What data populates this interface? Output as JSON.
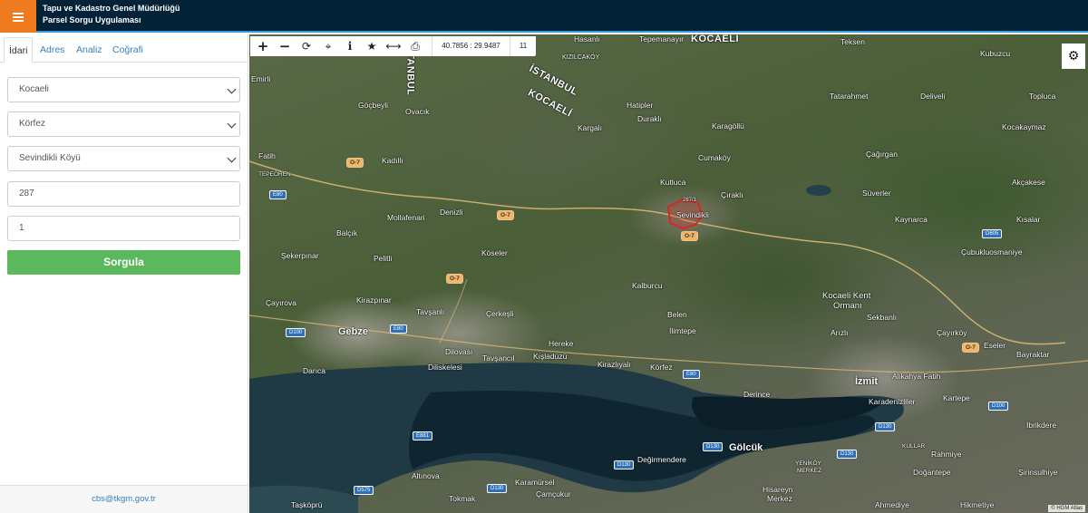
{
  "header": {
    "title_line1": "Tapu ve Kadastro Genel Müdürlüğü",
    "title_line2": "Parsel Sorgu Uygulaması"
  },
  "tabs": [
    {
      "label": "İdari",
      "active": true
    },
    {
      "label": "Adres"
    },
    {
      "label": "Analiz"
    },
    {
      "label": "Coğrafi"
    }
  ],
  "form": {
    "province": "Kocaeli",
    "district": "Körfez",
    "neighborhood": "Sevindikli Köyü",
    "block": "287",
    "parcel": "1",
    "query_label": "Sorgula"
  },
  "footer": {
    "email": "cbs@tkgm.gov.tr"
  },
  "toolbar": {
    "coords": "40.7856 : 29.9487",
    "zoom": "11",
    "icons": [
      "zoom-in-icon",
      "zoom-out-icon",
      "refresh-icon",
      "locate-icon",
      "info-icon",
      "star-icon",
      "measure-icon",
      "print-icon"
    ]
  },
  "map": {
    "attribution": "© HGM Atlas",
    "labels": {
      "hasanli": "Hasanlı",
      "tepemanayir": "Tepemanayır",
      "kocaeli_top": "KOCAELİ",
      "teksen": "Teksen",
      "kubuzcu": "Kubuzcu",
      "kizilcakoy": "KIZILCAKÖY",
      "istanbul_top": "İSTANBUL",
      "istanbul": "İSTANBUL",
      "kocaeli": "KOCAELİ",
      "tatarahmet": "Tatarahmet",
      "deliveli": "Deliveli",
      "topluca": "Topluca",
      "emirli": "Emirli",
      "gocbeyli": "Göçbeyli",
      "ovacik": "Ovacık",
      "hatipler": "Hatipler",
      "durakli": "Duraklı",
      "kargali": "Kargalı",
      "karagollu": "Karagöllü",
      "kocakaymaz": "Kocakaymaz",
      "cumakoy": "Cumaköy",
      "cagirgan": "Çağırgan",
      "fatih": "Fatih",
      "kadilli": "Kadıllı",
      "tepeoren": "TEPEÖREN",
      "kutluca": "Kutluca",
      "cirakli": "Çıraklı",
      "suverler": "Süverler",
      "akcakese": "Akçakese",
      "denizli": "Denizli",
      "mollafenari": "Mollafenari",
      "sevindikli": "Sevindikli",
      "kaynarca": "Kaynarca",
      "kisalar": "Kısalar",
      "balcik": "Balçık",
      "koseler": "Köseler",
      "cubukluosmaniye": "Çubukluosmaniye",
      "sekerpinar": "Şekerpınar",
      "pelitli": "Pelitli",
      "kalburcu": "Kalburcu",
      "kocaelikent": "Kocaeli Kent",
      "ormani": "Ormanı",
      "cayirova": "Çayırova",
      "kirazpinar": "Kirazpınar",
      "gebze": "Gebze",
      "tavsanli": "Tavşanlı",
      "cerkesli": "Çerkeşli",
      "belen": "Belen",
      "sekbanli": "Sekbanlı",
      "arizli": "Arızlı",
      "cayirkoy": "Çayırköy",
      "eseler": "Eseler",
      "bayraktar": "Bayraktar",
      "ilimtepe": "İlimtepe",
      "dilovasi": "Dilovası",
      "hereke": "Hereke",
      "kisladuzu": "Kışladüzü",
      "diliskelesi": "Diliskelesi",
      "tavsancil": "Tavşancıl",
      "kirazliyali": "Kirazlıyalı",
      "korfez": "Körfez",
      "darica": "Darıca",
      "izmit": "İzmit",
      "alikahya": "Alikahya Fatih",
      "derince": "Derince",
      "karadenizliler": "Karadenizliler",
      "kartepe": "Kartepe",
      "ibrikdere": "İbrikdere",
      "golcuk": "Gölcük",
      "degirmendere": "Değirmendere",
      "kullar": "KULLAR",
      "rahmiye": "Rahmiye",
      "yenikoy": "YENİKÖY",
      "merkez": "MERKEZ",
      "dogantepe": "Doğantepe",
      "sirinsulhiye": "Şirinsulhiye",
      "altinova": "Altınova",
      "karamursel": "Karamürsel",
      "camcukur": "Çamçukur",
      "hisareyn": "Hisareyn",
      "merkez2": "Merkez",
      "tasköprü": "Taşköprü",
      "tokmak": "Tokmak",
      "ahmediye": "Ahmediye",
      "hikmetiye": "Hikmetiye",
      "parcel_label": "287/1"
    },
    "roads": [
      "O-7",
      "O-7",
      "O-7",
      "O-7",
      "O-7",
      "O-7",
      "O-7"
    ],
    "highways": [
      "E80",
      "E80",
      "D100",
      "D100",
      "E80",
      "E881",
      "D605",
      "D100",
      "D130",
      "D130",
      "D130",
      "D130",
      "D575",
      "D130",
      "D130"
    ]
  }
}
